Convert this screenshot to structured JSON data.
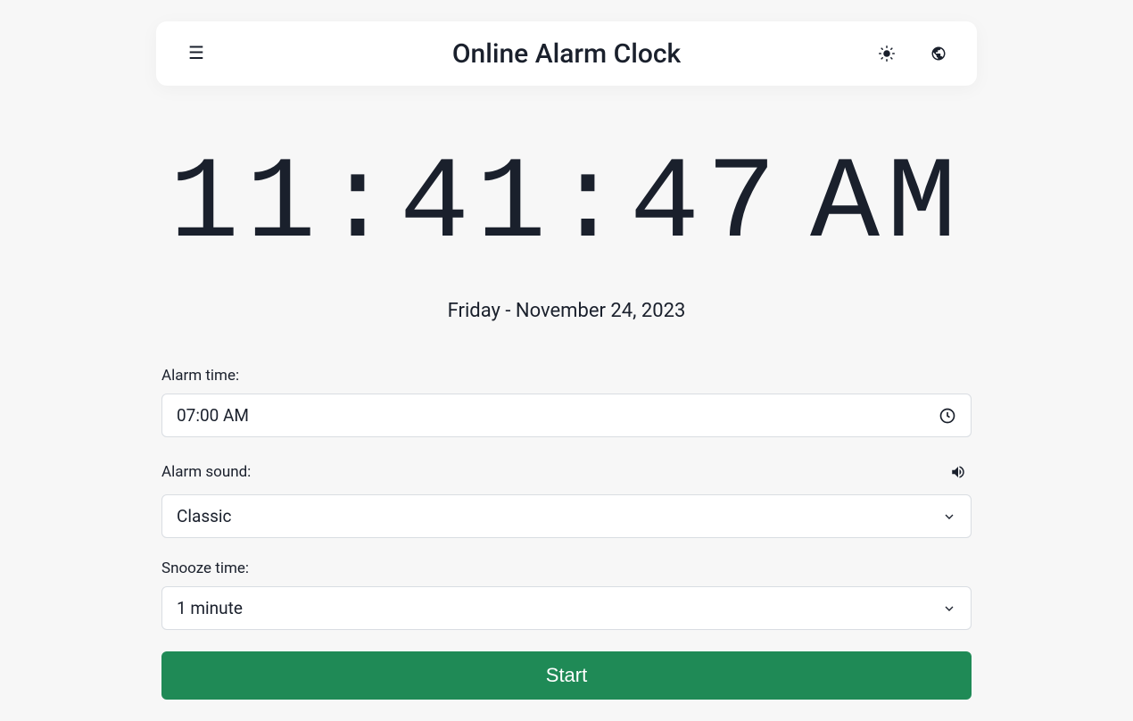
{
  "header": {
    "title": "Online Alarm Clock"
  },
  "clock": {
    "hours": "11",
    "minutes": "41",
    "seconds": "47",
    "meridiem": "AM",
    "date": "Friday - November 24, 2023"
  },
  "form": {
    "alarm_time_label": "Alarm time:",
    "alarm_time_value": "07:00 AM",
    "alarm_sound_label": "Alarm sound:",
    "alarm_sound_value": "Classic",
    "snooze_label": "Snooze time:",
    "snooze_value": "1 minute",
    "start_label": "Start"
  },
  "colors": {
    "primary_green": "#1f8a56",
    "background": "#f7f7f7",
    "card": "#ffffff",
    "text": "#1a202c",
    "border": "#d9dde2"
  }
}
